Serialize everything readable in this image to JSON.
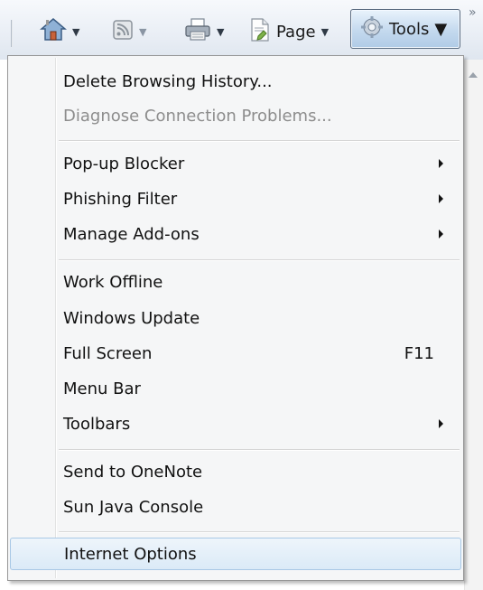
{
  "toolbar": {
    "home_icon": "home-icon",
    "feeds_icon": "feeds-icon",
    "print_icon": "print-icon",
    "page_label": "Page",
    "tools_label": "Tools",
    "overflow": "»"
  },
  "menu": {
    "items": [
      {
        "label": "Delete Browsing History...",
        "enabled": true
      },
      {
        "label": "Diagnose Connection Problems...",
        "enabled": false
      },
      {
        "label": "Pop-up Blocker",
        "submenu": true
      },
      {
        "label": "Phishing Filter",
        "submenu": true
      },
      {
        "label": "Manage Add-ons",
        "submenu": true
      },
      {
        "label": "Work Offline"
      },
      {
        "label": "Windows Update"
      },
      {
        "label": "Full Screen",
        "shortcut": "F11"
      },
      {
        "label": "Menu Bar"
      },
      {
        "label": "Toolbars",
        "submenu": true
      },
      {
        "label": "Send to OneNote"
      },
      {
        "label": "Sun Java Console"
      },
      {
        "label": "Internet Options",
        "highlighted": true
      }
    ]
  },
  "colors": {
    "menu_bg": "#f5f6f7",
    "highlight_border": "#a8c8e6",
    "disabled_text": "#8d8d8d"
  }
}
